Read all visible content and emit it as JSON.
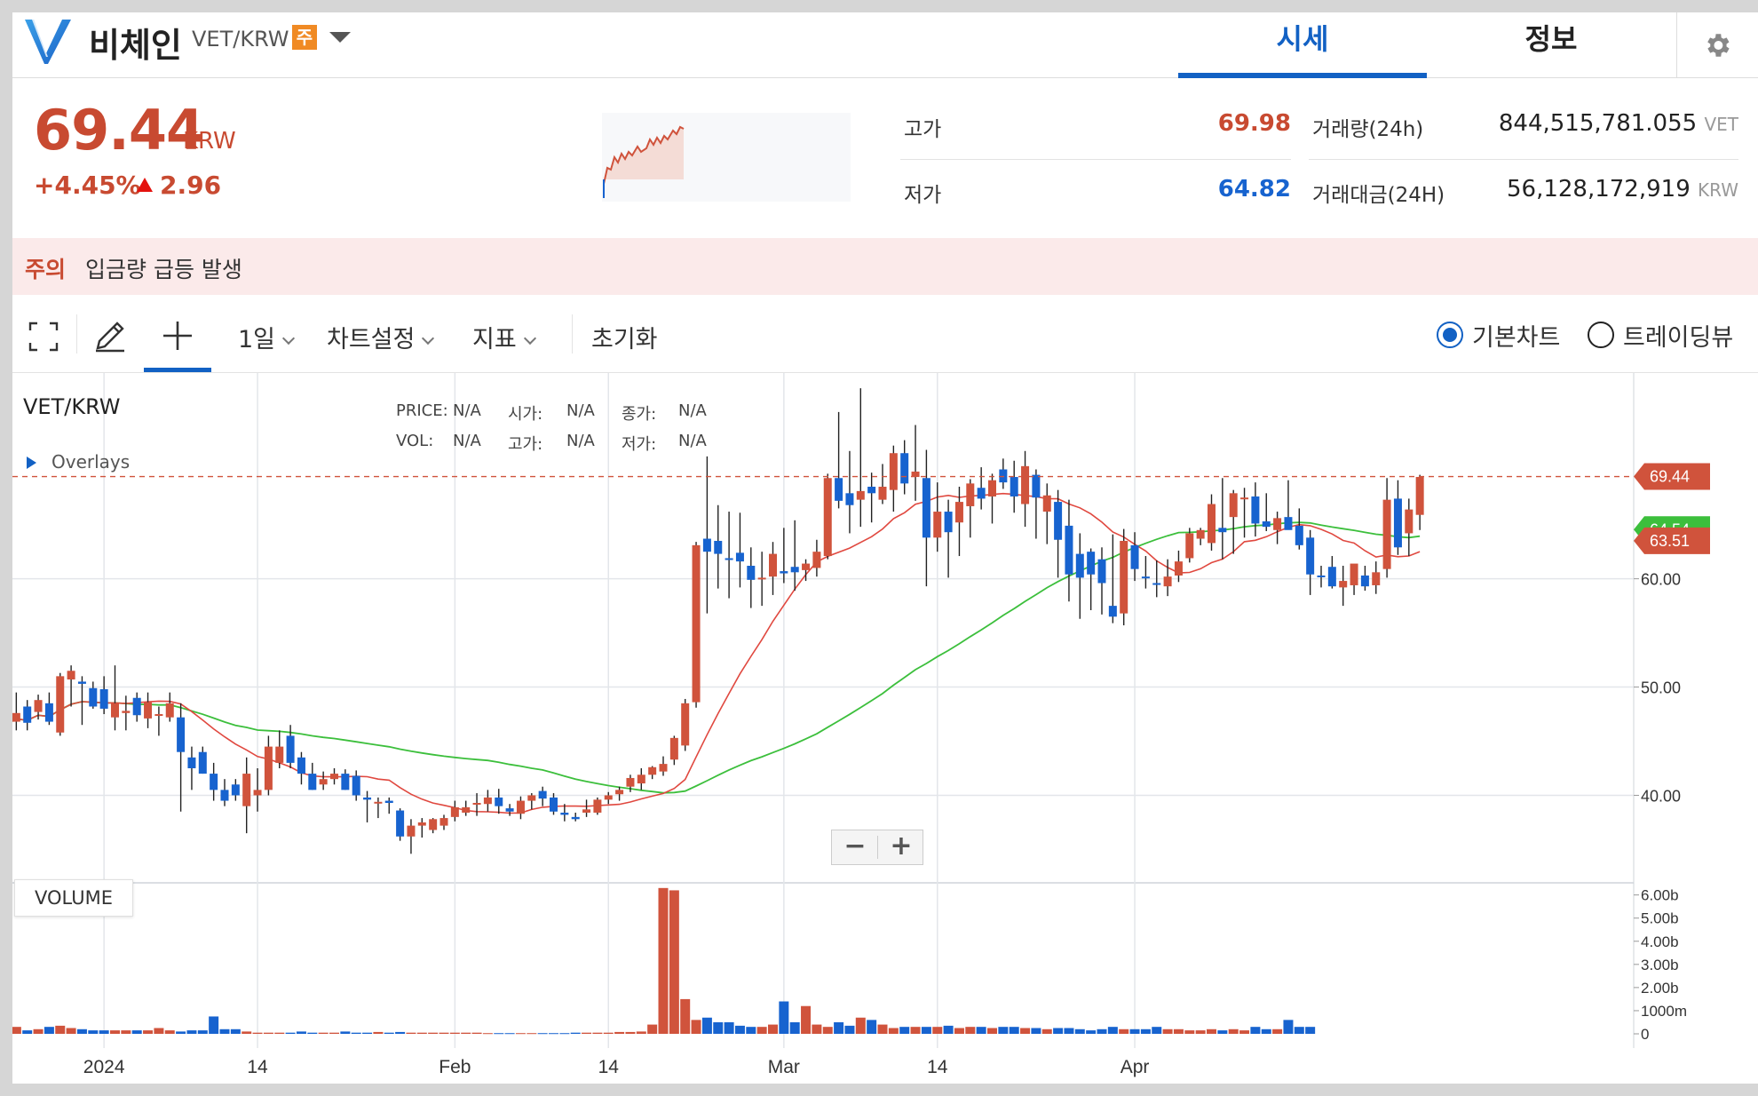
{
  "header": {
    "coin_name": "비체인",
    "pair": "VET/KRW",
    "warning_tag": "주",
    "tabs": [
      "시세",
      "정보"
    ]
  },
  "price": {
    "value": "69.44",
    "unit": "KRW",
    "change_pct": "+4.45%",
    "change_abs": "2.96"
  },
  "stats": {
    "high_label": "고가",
    "high_value": "69.98",
    "low_label": "저가",
    "low_value": "64.82",
    "volume_label": "거래량(24h)",
    "volume_value": "844,515,781.055",
    "volume_unit": "VET",
    "amount_label": "거래대금(24H)",
    "amount_value": "56,128,172,919",
    "amount_unit": "KRW"
  },
  "notice": {
    "tag": "주의",
    "text": "입금량 급등 발생"
  },
  "toolbar": {
    "interval": "1일",
    "chart_settings": "차트설정",
    "indicators": "지표",
    "reset": "초기화",
    "basic_chart": "기본차트",
    "tradingview": "트레이딩뷰"
  },
  "chart_header": {
    "symbol": "VET/KRW",
    "overlays": "Overlays",
    "price_label": "PRICE:",
    "price_val": "N/A",
    "vol_label": "VOL:",
    "vol_val": "N/A",
    "open_label": "시가:",
    "open_val": "N/A",
    "high_label": "고가:",
    "high_val": "N/A",
    "close_label": "종가:",
    "close_val": "N/A",
    "low_label": "저가:",
    "low_val": "N/A",
    "volume_pane": "VOLUME",
    "zoom_out": "−",
    "zoom_in": "+"
  },
  "colors": {
    "up": "#d0533c",
    "down": "#1763cf",
    "ma_short": "#e0483f",
    "ma_long": "#3cbf3c",
    "accent": "#1261c4"
  },
  "chart_data": {
    "type": "candlestick",
    "price_axis": {
      "ylim": [
        32,
        79
      ],
      "ticks": [
        {
          "value": 40,
          "label": "40.00"
        },
        {
          "value": 50,
          "label": "50.00"
        },
        {
          "value": 60,
          "label": "60.00"
        }
      ]
    },
    "volume_axis": {
      "ylim": [
        0,
        6.6
      ],
      "ticks": [
        {
          "value": 0,
          "label": "0"
        },
        {
          "value": 1,
          "label": "1000m"
        },
        {
          "value": 2,
          "label": "2.00b"
        },
        {
          "value": 3,
          "label": "3.00b"
        },
        {
          "value": 4,
          "label": "4.00b"
        },
        {
          "value": 5,
          "label": "5.00b"
        },
        {
          "value": 6,
          "label": "6.00b"
        }
      ]
    },
    "x_ticks": [
      {
        "index": 9,
        "label": "2024"
      },
      {
        "index": 23,
        "label": "14"
      },
      {
        "index": 41,
        "label": "Feb"
      },
      {
        "index": 55,
        "label": "14"
      },
      {
        "index": 71,
        "label": "Mar"
      },
      {
        "index": 85,
        "label": "14"
      },
      {
        "index": 103,
        "label": "Apr"
      }
    ],
    "price_tags": [
      {
        "value": 69.44,
        "label": "69.44",
        "color": "#d0533c",
        "dashed": true
      },
      {
        "value": 64.54,
        "label": "64.54",
        "color": "#3cbf3c"
      },
      {
        "value": 63.51,
        "label": "63.51",
        "color": "#d0533c"
      }
    ],
    "ohlc": [
      [
        46,
        47,
        43,
        46.5
      ],
      [
        46.8,
        49.5,
        46,
        47.6
      ],
      [
        48.2,
        48.8,
        46,
        46.7
      ],
      [
        47.7,
        49.3,
        47,
        48.8
      ],
      [
        48.5,
        49.5,
        46.5,
        46.8
      ],
      [
        45.8,
        51.3,
        45.5,
        51
      ],
      [
        50.7,
        52,
        48.2,
        51.5
      ],
      [
        50.5,
        51,
        46.5,
        50.3
      ],
      [
        49.9,
        50.5,
        48,
        48.2
      ],
      [
        49.8,
        51,
        47.5,
        48
      ],
      [
        47.2,
        52,
        46,
        48.5
      ],
      [
        47.6,
        49.2,
        46,
        47.8
      ],
      [
        49,
        49.5,
        46.8,
        47.4
      ],
      [
        47.1,
        49.5,
        46.2,
        48.6
      ],
      [
        47.4,
        48.2,
        45.5,
        47.5
      ],
      [
        47.2,
        49.5,
        46.8,
        48.5
      ],
      [
        47.2,
        48.5,
        38.5,
        44
      ],
      [
        43.5,
        44.5,
        40.5,
        42.5
      ],
      [
        44,
        44.5,
        42,
        42
      ],
      [
        42,
        43,
        39.5,
        40.5
      ],
      [
        40.5,
        41.5,
        39,
        39.5
      ],
      [
        41,
        41.5,
        39.5,
        40
      ],
      [
        39,
        43.5,
        36.5,
        42
      ],
      [
        40,
        42.5,
        38.5,
        40.5
      ],
      [
        40.5,
        45.5,
        40,
        44.5
      ],
      [
        43,
        46,
        42.5,
        44.5
      ],
      [
        45.5,
        46.5,
        42.5,
        43
      ],
      [
        43.5,
        44,
        41,
        42
      ],
      [
        42,
        43,
        40.5,
        40.5
      ],
      [
        41,
        42.2,
        40.5,
        41.5
      ],
      [
        41.5,
        42.5,
        41,
        42
      ],
      [
        42,
        42.4,
        40.5,
        40.5
      ],
      [
        41.8,
        42.3,
        39.5,
        40
      ],
      [
        39.8,
        40.4,
        37.5,
        39.6
      ],
      [
        39.3,
        39.8,
        37.9,
        39.4
      ],
      [
        39.5,
        39.8,
        38.3,
        39.3
      ],
      [
        38.6,
        38.8,
        35.8,
        36.2
      ],
      [
        36.2,
        37.8,
        34.6,
        37.2
      ],
      [
        37.2,
        37.9,
        36.1,
        37.5
      ],
      [
        36.8,
        37.9,
        36.5,
        37.8
      ],
      [
        37.2,
        38.2,
        36.8,
        37.9
      ],
      [
        38,
        39.5,
        37.6,
        38.9
      ],
      [
        38.4,
        39.5,
        38.1,
        38.9
      ],
      [
        39.3,
        40.2,
        38.1,
        39.3
      ],
      [
        39.2,
        40.5,
        38.5,
        39.8
      ],
      [
        39.8,
        40.6,
        38.3,
        39
      ],
      [
        38.8,
        39.2,
        38.1,
        38.5
      ],
      [
        38.3,
        39.9,
        37.8,
        39.5
      ],
      [
        39.5,
        40.2,
        38.7,
        40
      ],
      [
        40.4,
        40.8,
        39,
        39.7
      ],
      [
        39.8,
        40.2,
        38.2,
        38.5
      ],
      [
        38.4,
        39.2,
        37.6,
        38.2
      ],
      [
        38,
        38.4,
        37.6,
        37.8
      ],
      [
        38.4,
        39.6,
        38,
        38.7
      ],
      [
        38.4,
        39.8,
        38.2,
        39.6
      ],
      [
        39.6,
        40.3,
        39.2,
        40
      ],
      [
        40.1,
        40.8,
        39.5,
        40.5
      ],
      [
        40.8,
        41.9,
        40.3,
        41.6
      ],
      [
        41.1,
        42.5,
        40.5,
        41.9
      ],
      [
        41.9,
        42.7,
        41.5,
        42.6
      ],
      [
        42.2,
        43.6,
        41.8,
        42.9
      ],
      [
        43.3,
        45.5,
        42.8,
        45.3
      ],
      [
        44.6,
        48.9,
        44.1,
        48.5
      ],
      [
        48.6,
        63.4,
        48.1,
        63.1
      ],
      [
        63.7,
        71.3,
        56.8,
        62.5
      ],
      [
        63.5,
        66.8,
        59.1,
        62.3
      ],
      [
        61.9,
        66.2,
        58.2,
        61.8
      ],
      [
        62.4,
        66.1,
        59.2,
        61.6
      ],
      [
        61.2,
        62.9,
        57.3,
        59.9
      ],
      [
        60.1,
        62.5,
        57.5,
        60.1
      ],
      [
        60.2,
        63.4,
        58.5,
        62.3
      ],
      [
        60.7,
        64.7,
        59.6,
        60.5
      ],
      [
        61.1,
        65.4,
        58.9,
        60.6
      ],
      [
        60.8,
        61.8,
        59.8,
        61.4
      ],
      [
        61,
        63.6,
        60.2,
        62.5
      ],
      [
        62.1,
        69.7,
        61.8,
        69.3
      ],
      [
        69.3,
        75.4,
        66.5,
        67.2
      ],
      [
        67.9,
        71.8,
        64.2,
        66.8
      ],
      [
        67.3,
        77.6,
        64.8,
        68.1
      ],
      [
        68.5,
        69.8,
        65.2,
        67.9
      ],
      [
        67.3,
        70.6,
        66.9,
        68.5
      ],
      [
        68.2,
        72.3,
        66.2,
        71.6
      ],
      [
        71.6,
        72.8,
        67.8,
        68.8
      ],
      [
        69.4,
        74.2,
        67.2,
        69.9
      ],
      [
        69.3,
        71.9,
        59.3,
        63.8
      ],
      [
        63.8,
        68.9,
        62.5,
        66.2
      ],
      [
        66.2,
        67.3,
        60.1,
        64.3
      ],
      [
        65.2,
        68.5,
        62.1,
        67.1
      ],
      [
        66.7,
        69.2,
        63.8,
        68.8
      ],
      [
        68.4,
        70.3,
        66.4,
        67.4
      ],
      [
        67.6,
        69.7,
        65.1,
        69.1
      ],
      [
        70.1,
        71.1,
        68.3,
        68.9
      ],
      [
        69.4,
        70.9,
        66.1,
        67.6
      ],
      [
        66.9,
        71.8,
        64.8,
        70.4
      ],
      [
        69.6,
        70.1,
        63.7,
        67.5
      ],
      [
        66.2,
        68.8,
        63.2,
        67.7
      ],
      [
        67.1,
        68.2,
        60.1,
        63.6
      ],
      [
        64.9,
        67.3,
        57.9,
        60.4
      ],
      [
        62.3,
        64.2,
        56.3,
        60.1
      ],
      [
        62.5,
        62.8,
        57.1,
        60.4
      ],
      [
        61.8,
        62.9,
        56.7,
        59.6
      ],
      [
        57.5,
        64.1,
        55.9,
        56.5
      ],
      [
        56.8,
        64.6,
        55.7,
        63.5
      ],
      [
        63.1,
        64.3,
        59.8,
        60.9
      ],
      [
        60.2,
        62.1,
        59.1,
        60.1
      ],
      [
        59.6,
        61.7,
        58.3,
        59.5
      ],
      [
        59.3,
        61.8,
        58.4,
        60.2
      ],
      [
        60.3,
        62.6,
        59.7,
        61.6
      ],
      [
        61.9,
        64.7,
        61.5,
        64.2
      ],
      [
        63.7,
        64.7,
        63.1,
        64.5
      ],
      [
        63.3,
        67.8,
        62.6,
        66.9
      ],
      [
        64.7,
        69.3,
        61.8,
        64.3
      ],
      [
        65.7,
        68.2,
        62.3,
        67.9
      ],
      [
        67.4,
        68.4,
        63.8,
        67.5
      ],
      [
        67.6,
        68.9,
        63.9,
        65.1
      ],
      [
        65.3,
        67.9,
        64.4,
        64.8
      ],
      [
        64.5,
        66.2,
        63.2,
        65.6
      ],
      [
        65.7,
        69.1,
        64.8,
        64.5
      ],
      [
        64.9,
        66.5,
        62.7,
        63.1
      ],
      [
        63.8,
        64.5,
        58.5,
        60.4
      ],
      [
        60.3,
        61.2,
        59.2,
        60.2
      ],
      [
        61.1,
        62.1,
        59.1,
        59.3
      ],
      [
        59.2,
        61.2,
        57.5,
        59.8
      ],
      [
        59.4,
        60.2,
        58.5,
        61.4
      ],
      [
        60.3,
        61.2,
        58.9,
        59.3
      ],
      [
        59.4,
        61.6,
        58.6,
        60.6
      ],
      [
        60.9,
        69.3,
        60.1,
        67.3
      ],
      [
        67.4,
        69.1,
        62.2,
        62.9
      ],
      [
        64.2,
        67.4,
        62.1,
        66.4
      ],
      [
        65.9,
        69.6,
        64.5,
        69.4
      ]
    ],
    "volume": [
      0.5,
      0.3,
      0.15,
      0.2,
      0.3,
      0.35,
      0.25,
      0.2,
      0.15,
      0.15,
      0.15,
      0.15,
      0.15,
      0.15,
      0.25,
      0.15,
      0.1,
      0.15,
      0.15,
      0.75,
      0.2,
      0.2,
      0.1,
      0.05,
      0.05,
      0.05,
      0.05,
      0.1,
      0.05,
      0.05,
      0.05,
      0.1,
      0.05,
      0.05,
      0.08,
      0.05,
      0.08,
      0.05,
      0.05,
      0.05,
      0.05,
      0.05,
      0.05,
      0.05,
      0.03,
      0.03,
      0.03,
      0.03,
      0.03,
      0.03,
      0.03,
      0.03,
      0.05,
      0.05,
      0.05,
      0.05,
      0.08,
      0.08,
      0.1,
      0.4,
      6.3,
      6.2,
      1.5,
      0.6,
      0.7,
      0.5,
      0.5,
      0.35,
      0.3,
      0.3,
      0.4,
      1.4,
      0.5,
      1.2,
      0.4,
      0.3,
      0.5,
      0.35,
      0.7,
      0.6,
      0.4,
      0.25,
      0.3,
      0.3,
      0.3,
      0.3,
      0.35,
      0.25,
      0.3,
      0.3,
      0.25,
      0.3,
      0.3,
      0.25,
      0.25,
      0.2,
      0.25,
      0.25,
      0.2,
      0.15,
      0.2,
      0.3,
      0.2,
      0.2,
      0.2,
      0.3,
      0.2,
      0.2,
      0.15,
      0.15,
      0.2,
      0.15,
      0.2,
      0.15,
      0.3,
      0.2,
      0.2,
      0.6,
      0.3,
      0.3
    ]
  }
}
